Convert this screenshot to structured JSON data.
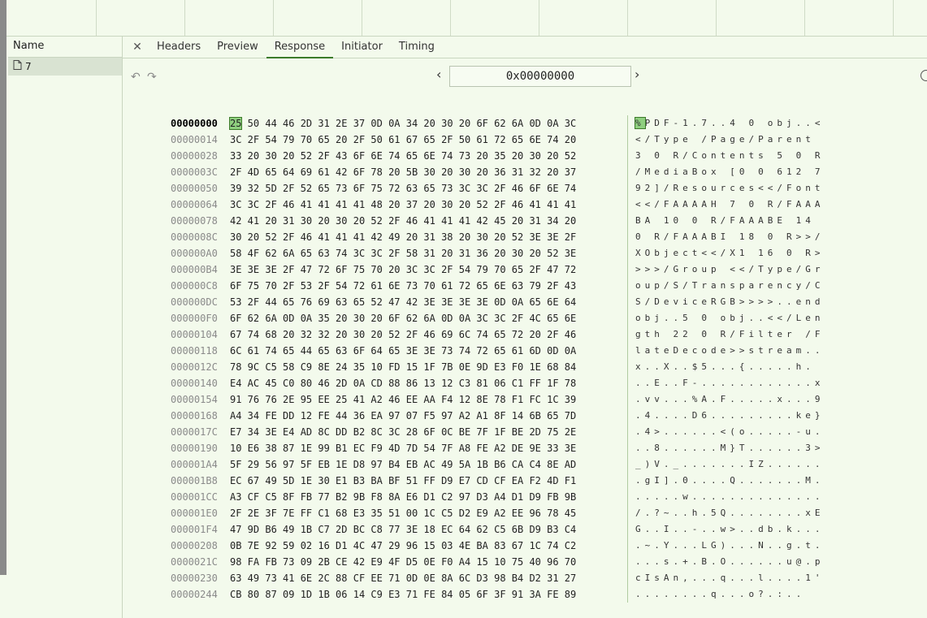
{
  "name_panel": {
    "header": "Name",
    "item": "7"
  },
  "tabs": [
    {
      "label": "Headers"
    },
    {
      "label": "Preview"
    },
    {
      "label": "Response",
      "active": true
    },
    {
      "label": "Initiator"
    },
    {
      "label": "Timing"
    }
  ],
  "address": "0x00000000",
  "rows": [
    {
      "offset": "00000000",
      "bytes": "25 50 44 46  2D 31 2E 37  0D 0A 34 20  30 20 6F 62  6A 0D 0A 3C",
      "ascii": "%PDF-1.7..4 0 obj..<"
    },
    {
      "offset": "00000014",
      "bytes": "3C 2F 54 79  70 65 20 2F  50 61 67 65  2F 50 61 72  65 6E 74 20",
      "ascii": "</Type /Page/Parent "
    },
    {
      "offset": "00000028",
      "bytes": "33 20 30 20  52 2F 43 6F  6E 74 65 6E  74 73 20 35  20 30 20 52",
      "ascii": "3 0 R/Contents 5 0 R"
    },
    {
      "offset": "0000003C",
      "bytes": "2F 4D 65 64  69 61 42 6F  78 20 5B 30  20 30 20 36  31 32 20 37",
      "ascii": "/MediaBox [0 0 612 7"
    },
    {
      "offset": "00000050",
      "bytes": "39 32 5D 2F  52 65 73 6F  75 72 63 65  73 3C 3C 2F  46 6F 6E 74",
      "ascii": "92]/Resources<</Font"
    },
    {
      "offset": "00000064",
      "bytes": "3C 3C 2F 46  41 41 41 41  48 20 37 20  30 20 52 2F  46 41 41 41",
      "ascii": "<</FAAAAH 7 0 R/FAAA"
    },
    {
      "offset": "00000078",
      "bytes": "42 41 20 31  30 20 30 20  52 2F 46 41  41 41 42 45  20 31 34 20",
      "ascii": "BA 10 0 R/FAAABE 14 "
    },
    {
      "offset": "0000008C",
      "bytes": "30 20 52 2F  46 41 41 41  42 49 20 31  38 20 30 20  52 3E 3E 2F",
      "ascii": "0 R/FAAABI 18 0 R>>/"
    },
    {
      "offset": "000000A0",
      "bytes": "58 4F 62 6A  65 63 74 3C  3C 2F 58 31  20 31 36 20  30 20 52 3E",
      "ascii": "XObject<</X1 16 0 R>"
    },
    {
      "offset": "000000B4",
      "bytes": "3E 3E 3E 2F  47 72 6F 75  70 20 3C 3C  2F 54 79 70  65 2F 47 72",
      "ascii": ">>>/Group <</Type/Gr"
    },
    {
      "offset": "000000C8",
      "bytes": "6F 75 70 2F  53 2F 54 72  61 6E 73 70  61 72 65 6E  63 79 2F 43",
      "ascii": "oup/S/Transparency/C"
    },
    {
      "offset": "000000DC",
      "bytes": "53 2F 44 65  76 69 63 65  52 47 42 3E  3E 3E 3E 0D  0A 65 6E 64",
      "ascii": "S/DeviceRGB>>>>..end"
    },
    {
      "offset": "000000F0",
      "bytes": "6F 62 6A 0D  0A 35 20 30  20 6F 62 6A  0D 0A 3C 3C  2F 4C 65 6E",
      "ascii": "obj..5 0 obj..<</Len"
    },
    {
      "offset": "00000104",
      "bytes": "67 74 68 20  32 32 20 30  20 52 2F 46  69 6C 74 65  72 20 2F 46",
      "ascii": "gth 22 0 R/Filter /F"
    },
    {
      "offset": "00000118",
      "bytes": "6C 61 74 65  44 65 63 6F  64 65 3E 3E  73 74 72 65  61 6D 0D 0A",
      "ascii": "lateDecode>>stream.."
    },
    {
      "offset": "0000012C",
      "bytes": "78 9C C5 58  C9 8E 24 35  10 FD 15 1F  7B 0E 9D E3  F0 1E 68 84",
      "ascii": "x..X..$5...{.....h."
    },
    {
      "offset": "00000140",
      "bytes": "E4 AC 45 C0  80 46 2D 0A  CD 88 86 13  12 C3 81 06  C1 FF 1F 78",
      "ascii": "..E..F-............x"
    },
    {
      "offset": "00000154",
      "bytes": "91 76 76 2E  95 EE 25 41  A2 46 EE AA  F4 12 8E 78  F1 FC 1C 39",
      "ascii": ".vv...%A.F.....x...9"
    },
    {
      "offset": "00000168",
      "bytes": "A4 34 FE DD  12 FE 44 36  EA 97 07 F5  97 A2 A1 8F  14 6B 65 7D",
      "ascii": ".4....D6.........ke}"
    },
    {
      "offset": "0000017C",
      "bytes": "E7 34 3E E4  AD 8C DD B2  8C 3C 28 6F  0C BE 7F 1F  BE 2D 75 2E",
      "ascii": ".4>......<(o.....-u."
    },
    {
      "offset": "00000190",
      "bytes": "10 E6 38 87  1E 99 B1 EC  F9 4D 7D 54  7F A8 FE A2  DE 9E 33 3E",
      "ascii": "..8......M}T......3>"
    },
    {
      "offset": "000001A4",
      "bytes": "5F 29 56 97  5F EB 1E D8  97 B4 EB AC  49 5A 1B B6  CA C4 8E AD",
      "ascii": "_)V._.......IZ......"
    },
    {
      "offset": "000001B8",
      "bytes": "EC 67 49 5D  1E 30 E1 B3  BA BF 51 FF  D9 E7 CD CF  EA F2 4D F1",
      "ascii": ".gI].0....Q.......M."
    },
    {
      "offset": "000001CC",
      "bytes": "A3 CF C5 8F  FB 77 B2 9B  F8 8A E6 D1  C2 97 D3 A4  D1 D9 FB 9B",
      "ascii": ".....w.............."
    },
    {
      "offset": "000001E0",
      "bytes": "2F 2E 3F 7E  FF C1 68 E3  35 51 00 1C  C5 D2 E9 A2  EE 96 78 45",
      "ascii": "/.?~..h.5Q........xE"
    },
    {
      "offset": "000001F4",
      "bytes": "47 9D B6 49  1B C7 2D BC  C8 77 3E 18  EC 64 62 C5  6B D9 B3 C4",
      "ascii": "G..I..-..w>..db.k..."
    },
    {
      "offset": "00000208",
      "bytes": "0B 7E 92 59  02 16 D1 4C  47 29 96 15  03 4E BA 83  67 1C 74 C2",
      "ascii": ".~.Y...LG)...N..g.t."
    },
    {
      "offset": "0000021C",
      "bytes": "98 FA FB 73  09 2B CE 42  E9 4F D5 0E  F0 A4 15 10  75 40 96 70",
      "ascii": "...s.+.B.O......u@.p"
    },
    {
      "offset": "00000230",
      "bytes": "63 49 73 41  6E 2C 88 CF  EE 71 0D 0E  8A 6C D3 98  B4 D2 31 27",
      "ascii": "cIsAn,...q...l....1'"
    },
    {
      "offset": "00000244",
      "bytes": "CB 80 87 09  1D 1B 06 14  C9 E3 71 FE  84 05 6F 3F  91 3A FE 89",
      "ascii": "........q...o?.:.."
    }
  ]
}
